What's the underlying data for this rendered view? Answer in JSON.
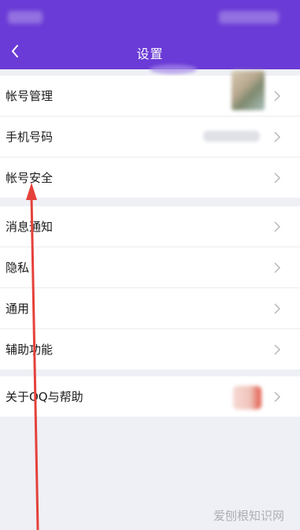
{
  "header": {
    "title": "设置"
  },
  "groups": [
    {
      "items": [
        {
          "label": "帐号管理"
        },
        {
          "label": "手机号码"
        },
        {
          "label": "帐号安全"
        }
      ]
    },
    {
      "items": [
        {
          "label": "消息通知"
        },
        {
          "label": "隐私"
        },
        {
          "label": "通用"
        },
        {
          "label": "辅助功能"
        }
      ]
    },
    {
      "items": [
        {
          "label": "关于QQ与帮助"
        }
      ]
    }
  ],
  "watermark": "爱刨根知识网",
  "colors": {
    "header_bg": "#6a3bd6",
    "annotation_arrow": "#e5413a",
    "page_bg": "#eef0f5"
  },
  "icons": {
    "back": "chevron-left-icon",
    "row": "chevron-right-icon"
  }
}
